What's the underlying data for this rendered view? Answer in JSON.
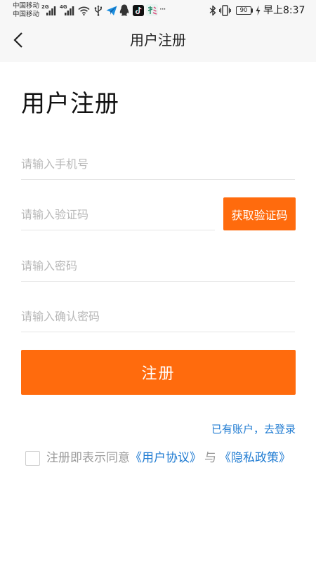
{
  "status_bar": {
    "carrier_1": "中国移动",
    "carrier_2": "中国移动",
    "network_1": "2G",
    "network_2": "4G",
    "more": "···",
    "battery": "90",
    "time": "早上8:37",
    "icons": {
      "signal": "signal-bars-icon",
      "wifi": "wifi-icon",
      "usb": "usb-icon",
      "plane": "paper-plane-icon",
      "qq": "qq-penguin-icon",
      "tiktok": "tiktok-icon",
      "app": "app-notification-icon",
      "bluetooth": "bluetooth-icon",
      "vibrate": "vibrate-icon",
      "battery": "battery-icon",
      "charging": "charging-bolt-icon"
    }
  },
  "nav": {
    "title": "用户注册",
    "back_icon": "chevron-left-icon"
  },
  "form": {
    "heading": "用户注册",
    "phone_placeholder": "请输入手机号",
    "code_placeholder": "请输入验证码",
    "get_code_label": "获取验证码",
    "password_placeholder": "请输入密码",
    "confirm_placeholder": "请输入确认密码",
    "submit_label": "注册",
    "login_link": "已有账户，去登录",
    "agreement": {
      "checked": false,
      "prefix": "注册即表示同意",
      "user_agreement": "《用户协议》",
      "conjunction": "与",
      "privacy_policy": "《隐私政策》"
    }
  },
  "theme": {
    "accent": "#ff6b0d",
    "link": "#1f7bd2",
    "placeholder": "#b8b8b8",
    "divider": "#e6e6e6"
  }
}
